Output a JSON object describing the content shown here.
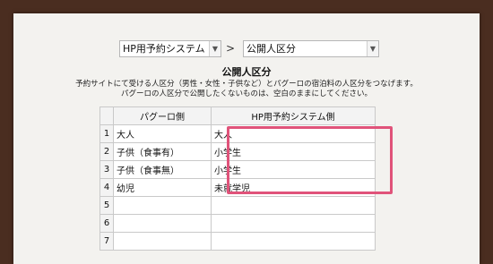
{
  "selects": {
    "system": "HP用予約システム",
    "separator": ">",
    "category": "公開人区分"
  },
  "title": "公開人区分",
  "description": [
    "予約サイトにて受ける人区分（男性・女性・子供など）とパグーロの宿泊料の人区分をつなげます。",
    "パグーロの人区分で公開したくないものは、空白のままにしてください。"
  ],
  "table": {
    "headers": [
      "",
      "パグーロ側",
      "HP用予約システム側"
    ],
    "rows": [
      {
        "num": "1",
        "left": "大人",
        "right": "大人"
      },
      {
        "num": "2",
        "left": "子供（食事有）",
        "right": "小学生"
      },
      {
        "num": "3",
        "left": "子供（食事無）",
        "right": "小学生"
      },
      {
        "num": "4",
        "left": "幼児",
        "right": "未就学児"
      },
      {
        "num": "5",
        "left": "",
        "right": ""
      },
      {
        "num": "6",
        "left": "",
        "right": ""
      },
      {
        "num": "7",
        "left": "",
        "right": ""
      }
    ]
  },
  "colors": {
    "highlight": "#e0537a",
    "background": "#4a2d20",
    "panel": "#f3f2ef"
  }
}
